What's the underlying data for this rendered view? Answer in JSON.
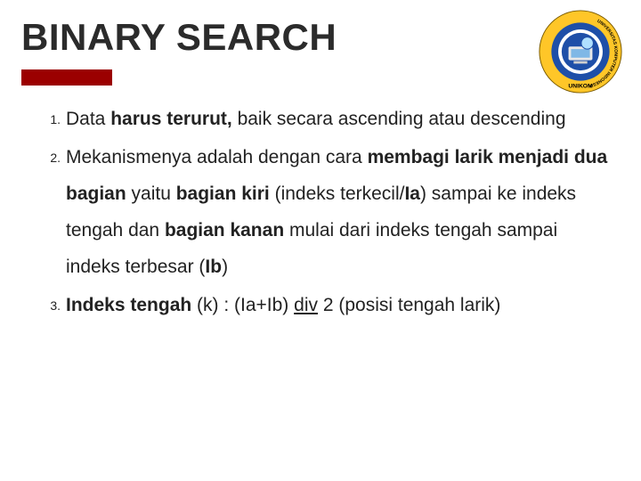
{
  "title": "BINARY SEARCH",
  "logo": {
    "name": "university-logo",
    "outer_ring": "#FFC628",
    "blue": "#1E4FA8",
    "ring_text_top": "UNIVERSITAS KOMPUTER INDONESIA",
    "ring_text_bottom": "UNIKOM"
  },
  "items": [
    {
      "num": "1.",
      "runs": [
        {
          "t": "Data ",
          "b": false,
          "u": false
        },
        {
          "t": "harus terurut,",
          "b": true,
          "u": false
        },
        {
          "t": " baik secara ",
          "b": false,
          "u": false
        },
        {
          "t": "ascending ",
          "b": false,
          "u": false
        },
        {
          "t": "atau ",
          "b": false,
          "u": false
        },
        {
          "t": "descending",
          "b": false,
          "u": false
        }
      ]
    },
    {
      "num": "2.",
      "runs": [
        {
          "t": "Mekanismenya adalah dengan cara ",
          "b": false,
          "u": false
        },
        {
          "t": "membagi larik menjadi dua bagian",
          "b": true,
          "u": false
        },
        {
          "t": " yaitu ",
          "b": false,
          "u": false
        },
        {
          "t": "bagian kiri",
          "b": true,
          "u": false
        },
        {
          "t": " (indeks terkecil/",
          "b": false,
          "u": false
        },
        {
          "t": "Ia",
          "b": true,
          "u": false
        },
        {
          "t": ") sampai ke indeks tengah dan ",
          "b": false,
          "u": false
        },
        {
          "t": "bagian kanan",
          "b": true,
          "u": false
        },
        {
          "t": " mulai dari indeks tengah sampai indeks terbesar (",
          "b": false,
          "u": false
        },
        {
          "t": "Ib",
          "b": true,
          "u": false
        },
        {
          "t": ")",
          "b": false,
          "u": false
        }
      ]
    },
    {
      "num": "3.",
      "runs": [
        {
          "t": " ",
          "b": false,
          "u": false
        },
        {
          "t": "Indeks tengah",
          "b": true,
          "u": false
        },
        {
          "t": " (k) : (Ia+Ib) ",
          "b": false,
          "u": false
        },
        {
          "t": "div",
          "b": false,
          "u": true
        },
        {
          "t": " 2 (posisi tengah larik)",
          "b": false,
          "u": false
        }
      ]
    }
  ]
}
